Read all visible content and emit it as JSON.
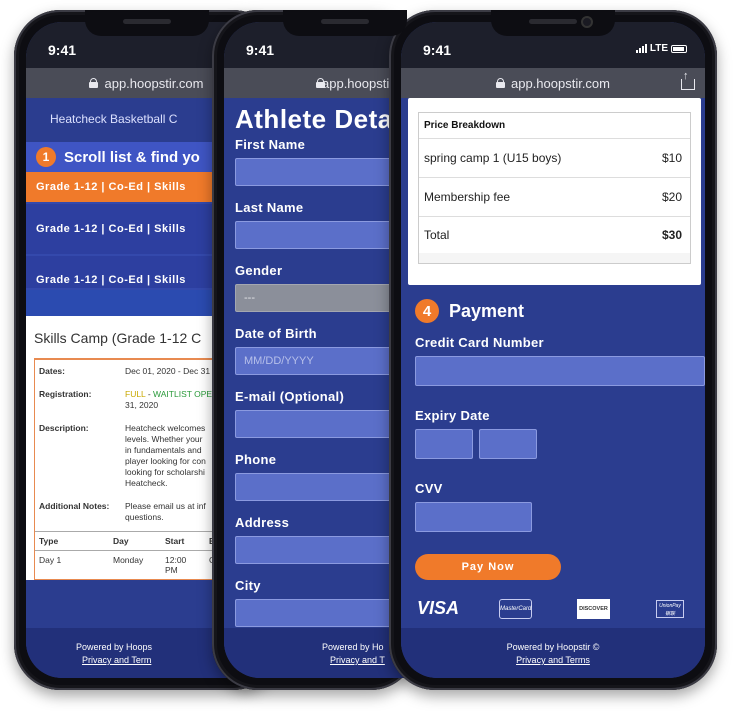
{
  "status": {
    "time": "9:41",
    "network": "LTE"
  },
  "url": "app.hoopstir.com",
  "footer": {
    "powered": "Powered by Hoopstir ©",
    "powered_cut": "Powered by Hoops",
    "powered_cut2": "Powered by Ho",
    "links": "Privacy and Terms",
    "links_cut": "Privacy and Term",
    "links_cut2": "Privacy and T"
  },
  "phone1": {
    "header": "Heatcheck Basketball C",
    "step_num": "1",
    "step_label": "Scroll list & find yo",
    "rows": [
      "Grade 1-12 | Co-Ed | Skills",
      "Grade 1-12 | Co-Ed | Skills",
      "Grade 1-12 | Co-Ed | Skills"
    ],
    "camp_title": "Skills Camp (Grade 1-12 C",
    "details": {
      "dates_k": "Dates:",
      "dates_v": "Dec 01, 2020 - Dec 31",
      "reg_k": "Registration:",
      "reg_full": "FULL",
      "reg_dash": " - ",
      "reg_wait": "WAITLIST OPE",
      "reg_date": "31, 2020",
      "desc_k": "Description:",
      "desc_v": "Heatcheck welcomes levels. Whether your in fundamentals and player looking for con looking for scholarshi Heatcheck.",
      "notes_k": "Additional Notes:",
      "notes_v": "Please email us at inf questions."
    },
    "table": {
      "headers": [
        "Type",
        "Day",
        "Start",
        "E"
      ],
      "row": [
        "Day 1",
        "Monday",
        "12:00 PM",
        "C"
      ]
    }
  },
  "phone2": {
    "title": "Athlete Deta",
    "fields": [
      {
        "label": "First Name",
        "placeholder": ""
      },
      {
        "label": "Last Name",
        "placeholder": ""
      },
      {
        "label": "Gender",
        "placeholder": "---"
      },
      {
        "label": "Date of Birth",
        "placeholder": "MM/DD/YYYY"
      },
      {
        "label": "E-mail (Optional)",
        "placeholder": ""
      },
      {
        "label": "Phone",
        "placeholder": ""
      },
      {
        "label": "Address",
        "placeholder": ""
      },
      {
        "label": "City",
        "placeholder": ""
      }
    ]
  },
  "phone3": {
    "price_title": "Price Breakdown",
    "items": [
      {
        "name": "spring camp 1 (U15 boys)",
        "amount": "$10"
      },
      {
        "name": "Membership fee",
        "amount": "$20"
      }
    ],
    "total": {
      "name": "Total",
      "amount": "$30"
    },
    "step_num": "4",
    "step_label": "Payment",
    "cc_label": "Credit Card Number",
    "expiry_label": "Expiry Date",
    "cvv_label": "CVV",
    "pay_label": "Pay Now",
    "cards": {
      "visa": "VISA",
      "mastercard": "MasterCard",
      "discover": "DISCOVER",
      "unionpay": "UnionPay 银联"
    }
  },
  "colors": {
    "accent": "#f07a2a",
    "page_bg": "#2b3d8f",
    "input_bg": "#5b6fc9"
  }
}
